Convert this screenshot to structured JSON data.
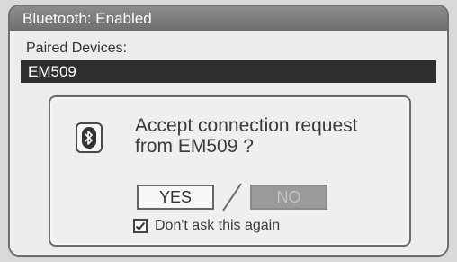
{
  "header": {
    "title": "Bluetooth: Enabled"
  },
  "paired": {
    "label": "Paired Devices:",
    "selected_device": "EM509"
  },
  "dialog": {
    "message_line1": "Accept connection request",
    "message_line2": "from EM509 ?",
    "yes_label": "YES",
    "no_label": "NO",
    "separator": "/",
    "checkbox_label": "Don't ask this again",
    "checkbox_checked": true,
    "icon": "bluetooth-icon"
  },
  "colors": {
    "titlebar": "#7a7a7a",
    "selected_row": "#2f2f2f",
    "disabled_button": "#9a9a9a"
  }
}
